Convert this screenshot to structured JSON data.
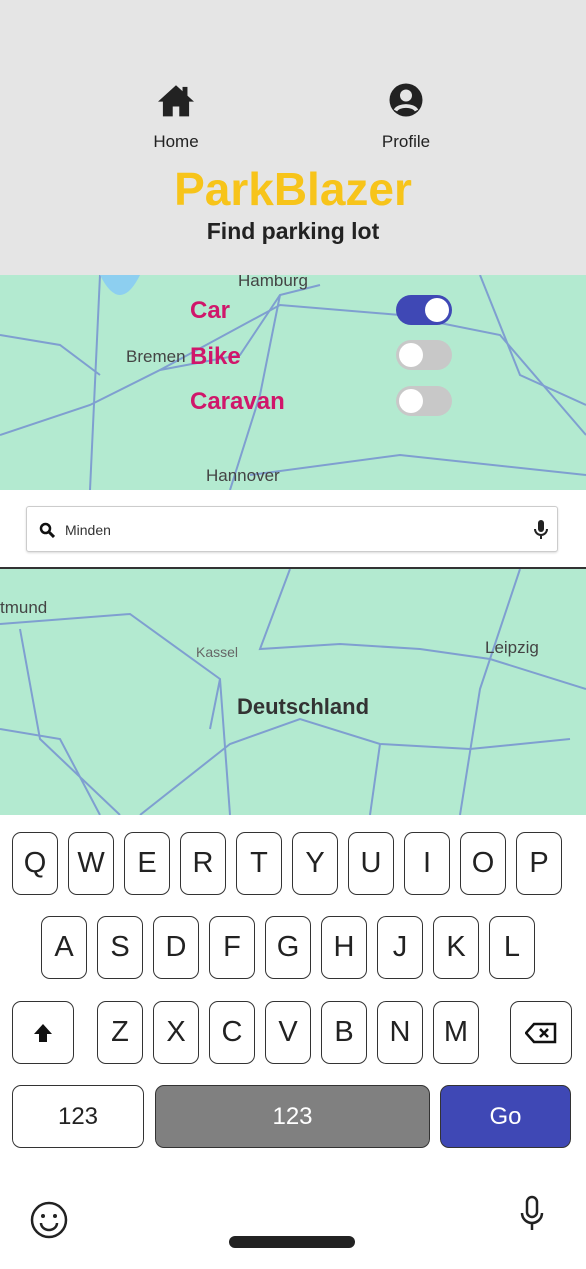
{
  "header": {
    "nav": [
      {
        "label": "Home",
        "icon": "home-icon"
      },
      {
        "label": "Profile",
        "icon": "account-circle-icon"
      }
    ],
    "title": "ParkBlazer",
    "subtitle": "Find parking lot",
    "title_color": "#f7c41a"
  },
  "map_top": {
    "cities": [
      "Hamburg",
      "Bremen",
      "Hannover"
    ]
  },
  "vehicle_options": [
    {
      "label": "Car",
      "enabled": true
    },
    {
      "label": "Bike",
      "enabled": false
    },
    {
      "label": "Caravan",
      "enabled": false
    }
  ],
  "search": {
    "value": "Minden",
    "icon": "search-icon",
    "mic_icon": "mic-icon"
  },
  "map_bottom": {
    "cities": [
      "tmund",
      "Kassel",
      "Leipzig"
    ],
    "country": "Deutschland"
  },
  "keyboard": {
    "row1": [
      "Q",
      "W",
      "E",
      "R",
      "T",
      "Y",
      "U",
      "I",
      "O",
      "P"
    ],
    "row2": [
      "A",
      "S",
      "D",
      "F",
      "G",
      "H",
      "J",
      "K",
      "L"
    ],
    "row3": [
      "Z",
      "X",
      "C",
      "V",
      "B",
      "N",
      "M"
    ],
    "numbers_label": "123",
    "space_label": "123",
    "go_label": "Go",
    "accent": "#3f48b5"
  }
}
